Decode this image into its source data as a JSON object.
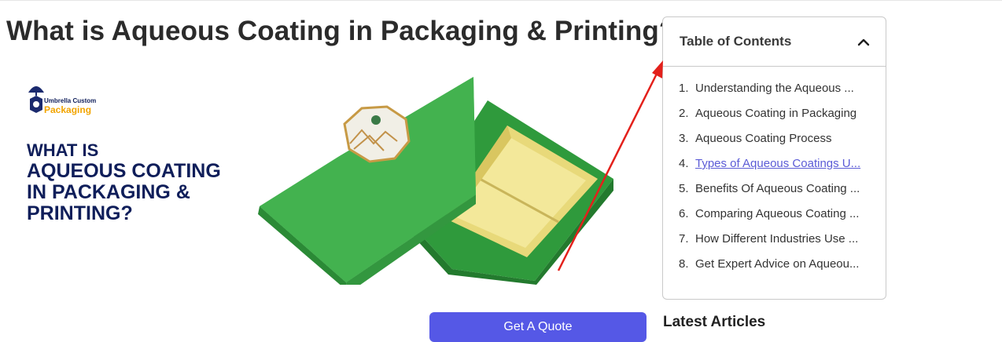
{
  "article": {
    "title": "What is Aqueous Coating in Packaging & Printing?"
  },
  "hero": {
    "logo_top": "Umbrella Custom",
    "logo_bottom": "Packaging",
    "line1": "WHAT IS",
    "line2": "AQUEOUS COATING",
    "line3": "IN PACKAGING &",
    "line4": "PRINTING?"
  },
  "cta": {
    "label": "Get A Quote"
  },
  "toc": {
    "title": "Table of Contents",
    "items": [
      {
        "num": "1.",
        "label": "Understanding the Aqueous ..."
      },
      {
        "num": "2.",
        "label": "Aqueous Coating in Packaging"
      },
      {
        "num": "3.",
        "label": "Aqueous Coating Process"
      },
      {
        "num": "4.",
        "label": "Types of Aqueous Coatings U..."
      },
      {
        "num": "5.",
        "label": "Benefits Of Aqueous Coating ..."
      },
      {
        "num": "6.",
        "label": "Comparing Aqueous Coating ..."
      },
      {
        "num": "7.",
        "label": "How Different Industries Use ..."
      },
      {
        "num": "8.",
        "label": "Get Expert Advice on Aqueou..."
      }
    ],
    "active_index": 3
  },
  "sidebar": {
    "latest_heading": "Latest Articles"
  },
  "colors": {
    "accent": "#5558e6",
    "link": "#5b5bd6",
    "annotation_arrow": "#e3201b",
    "box_green": "#3fa84a"
  },
  "icons": [
    "chevron-up-icon",
    "umbrella-logo-icon"
  ]
}
